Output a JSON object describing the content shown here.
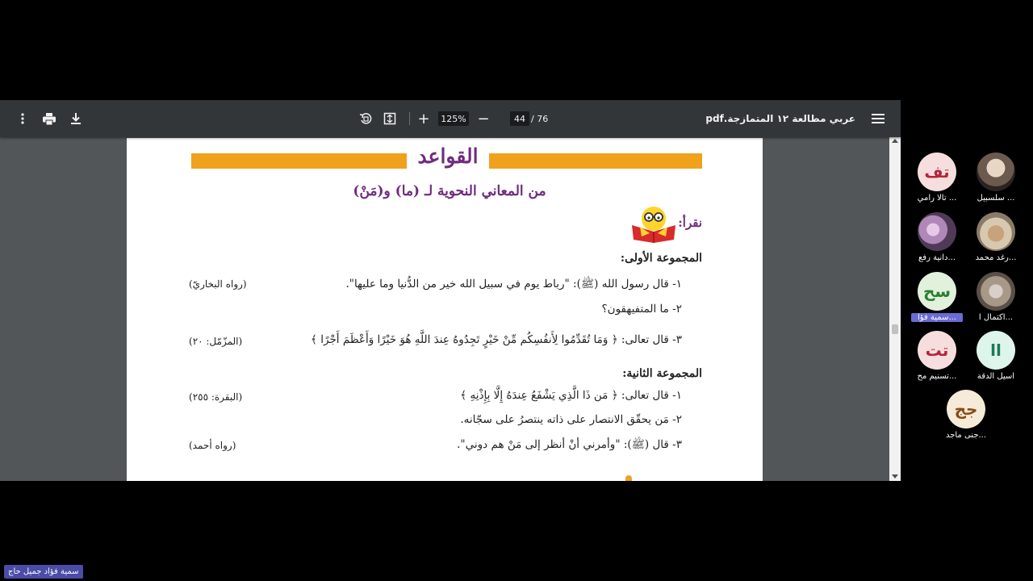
{
  "viewer": {
    "doc_title": "عربي مطالعة ١٢ المتمازجة.pdf",
    "page_current": "44",
    "page_sep_total": "/ 76",
    "zoom": "125%",
    "zoom_plus": "+",
    "zoom_minus": "−"
  },
  "page": {
    "lesson_title": "القواعد",
    "subtitle": "من المعاني النحوية لـ (ما) و(مَنْ)",
    "read_label": "نقرأ:",
    "group1": {
      "title": "المجموعة الأولى:",
      "items": [
        {
          "text": "١- قال رسول الله (ﷺ): \"رباط يوم في سبيل الله خير من الدُّنيا وما عليها\".",
          "source": "(رواه البخاريّ)"
        },
        {
          "text": "٢- ما المتفيهقون؟",
          "source": ""
        },
        {
          "text": "٣- قال تعالى: ﴿ وَمَا تُقَدِّمُوا لِأَنفُسِكُم مِّنْ خَيْرٍ تَجِدُوهُ عِندَ اللَّهِ هُوَ خَيْرًا وَأَعْظَمَ أَجْرًا ﴾",
          "source": "(المزّمّل: ٢٠)"
        }
      ]
    },
    "group2": {
      "title": "المجموعة الثانية:",
      "items": [
        {
          "text": "١- قال تعالى: ﴿ مَن ذَا الَّذِي يَشْفَعُ عِندَهُ إِلَّا بِإِذْنِهِ ﴾",
          "source": "(البقرة: ٢٥٥)"
        },
        {
          "text": "٢- مَن يحقّق الانتصار على ذاته ينتصرُ على سجّانه.",
          "source": ""
        },
        {
          "text": "٣- قال (ﷺ): \"وأمرني أنْ أنظر إلى مَنْ هم دوني\".",
          "source": "(رواه أحمد)"
        }
      ]
    }
  },
  "participants": [
    {
      "initials": "تف",
      "name": "... تالا رامي",
      "color": "#f7dede",
      "text_color": "#b5253a"
    },
    {
      "initials": "",
      "name": "... سلسبيل",
      "photo": true
    },
    {
      "initials": "",
      "name": "...دانية رفع",
      "photo": true
    },
    {
      "initials": "",
      "name": "...رغد محمد",
      "photo": true
    },
    {
      "initials": "سح",
      "name": "...سمية فؤا",
      "color": "#e1f1dc",
      "text_color": "#2e7d32"
    },
    {
      "initials": "",
      "name": "...اكتمال ا",
      "photo": true
    },
    {
      "initials": "تت",
      "name": "...تسنيم مح",
      "color": "#f7dede",
      "text_color": "#b5253a"
    },
    {
      "initials": "اا",
      "name": "اسيل الدقة",
      "color": "#def5ec",
      "text_color": "#1b7a55"
    },
    {
      "initials": "جج",
      "name": "...جنى ماجد",
      "color": "#f6ead9",
      "text_color": "#8a4a12"
    }
  ],
  "self_label": "سمية فؤاد جميل حاج",
  "icons": [
    "menu-icon",
    "fit-page-icon",
    "rotate-icon",
    "download-icon",
    "print-icon",
    "more-vert-icon",
    "reading-book-mascot"
  ]
}
